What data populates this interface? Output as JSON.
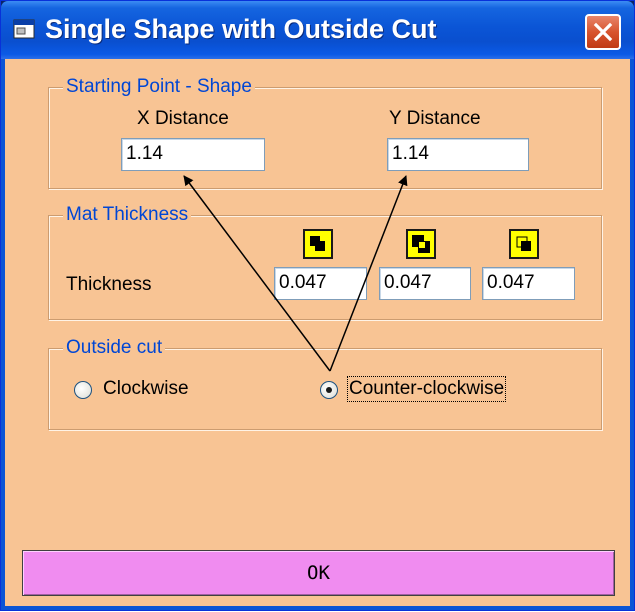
{
  "window": {
    "title": "Single Shape with Outside Cut",
    "icon": "app-window-icon",
    "close_icon": "close-icon"
  },
  "starting_point": {
    "legend": "Starting Point - Shape",
    "x_label": "X Distance",
    "x_value": "1.14",
    "y_label": "Y Distance",
    "y_value": "1.14"
  },
  "mat_thickness": {
    "legend": "Mat Thickness",
    "label": "Thickness",
    "fields": [
      {
        "icon": "mat-layer-top-icon",
        "value": "0.047"
      },
      {
        "icon": "mat-layer-middle-icon",
        "value": "0.047"
      },
      {
        "icon": "mat-layer-bottom-icon",
        "value": "0.047"
      }
    ]
  },
  "outside_cut": {
    "legend": "Outside cut",
    "options": [
      {
        "label": "Clockwise",
        "selected": false
      },
      {
        "label": "Counter-clockwise",
        "selected": true
      }
    ]
  },
  "ok_button": {
    "label": "OK"
  },
  "colors": {
    "client_bg": "#f8c494",
    "legend_text": "#0046d5",
    "ok_bg": "#f08cf0",
    "swatch_yellow": "#ffff00",
    "titlebar_blue": "#0b55d6"
  }
}
